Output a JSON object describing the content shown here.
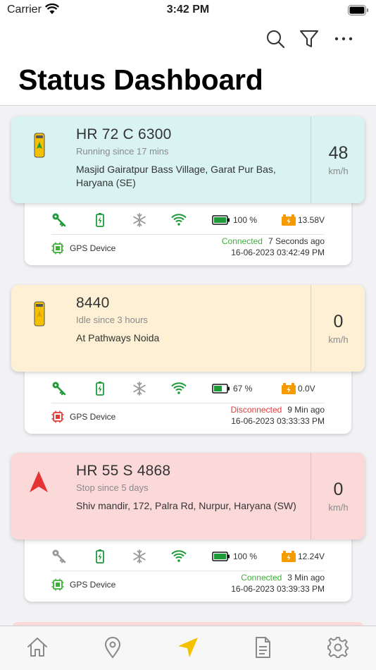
{
  "status_bar": {
    "carrier": "Carrier",
    "time": "3:42 PM"
  },
  "header": {
    "title": "Status Dashboard"
  },
  "colors": {
    "running_bg": "#d8f3f1",
    "idle_bg": "#fdf0d4",
    "stop_bg": "#fcd9d9",
    "connected": "#3fae39",
    "disconnected": "#e03a3a",
    "accent": "#f5c000"
  },
  "vehicles": [
    {
      "plate": "HR 72 C 6300",
      "since": "Running since 17 mins",
      "address": "Masjid Gairatpur Bass Village, Garat Pur Bas, Haryana (SE)",
      "speed": "48",
      "unit": "km/h",
      "battery_pct": "100 %",
      "voltage": "13.58V",
      "device": "GPS Device",
      "conn_status": "Connected",
      "conn_ago": "7 Seconds ago",
      "datetime": "16-06-2023 03:42:49 PM"
    },
    {
      "plate": "8440",
      "since": "Idle since 3 hours",
      "address": "At Pathways Noida",
      "speed": "0",
      "unit": "km/h",
      "battery_pct": "67 %",
      "voltage": "0.0V",
      "device": "GPS Device",
      "conn_status": "Disconnected",
      "conn_ago": "9 Min ago",
      "datetime": "16-06-2023 03:33:33 PM"
    },
    {
      "plate": "HR 55 S 4868",
      "since": "Stop since 5 days",
      "address": "Shiv mandir, 172, Palra Rd, Nurpur, Haryana (SW)",
      "speed": "0",
      "unit": "km/h",
      "battery_pct": "100 %",
      "voltage": "12.24V",
      "device": "GPS Device",
      "conn_status": "Connected",
      "conn_ago": "3 Min ago",
      "datetime": "16-06-2023 03:39:33 PM"
    }
  ],
  "tabs": [
    {
      "icon": "home-icon"
    },
    {
      "icon": "location-pin-icon"
    },
    {
      "icon": "navigation-arrow-icon"
    },
    {
      "icon": "document-icon"
    },
    {
      "icon": "settings-gear-icon"
    }
  ]
}
